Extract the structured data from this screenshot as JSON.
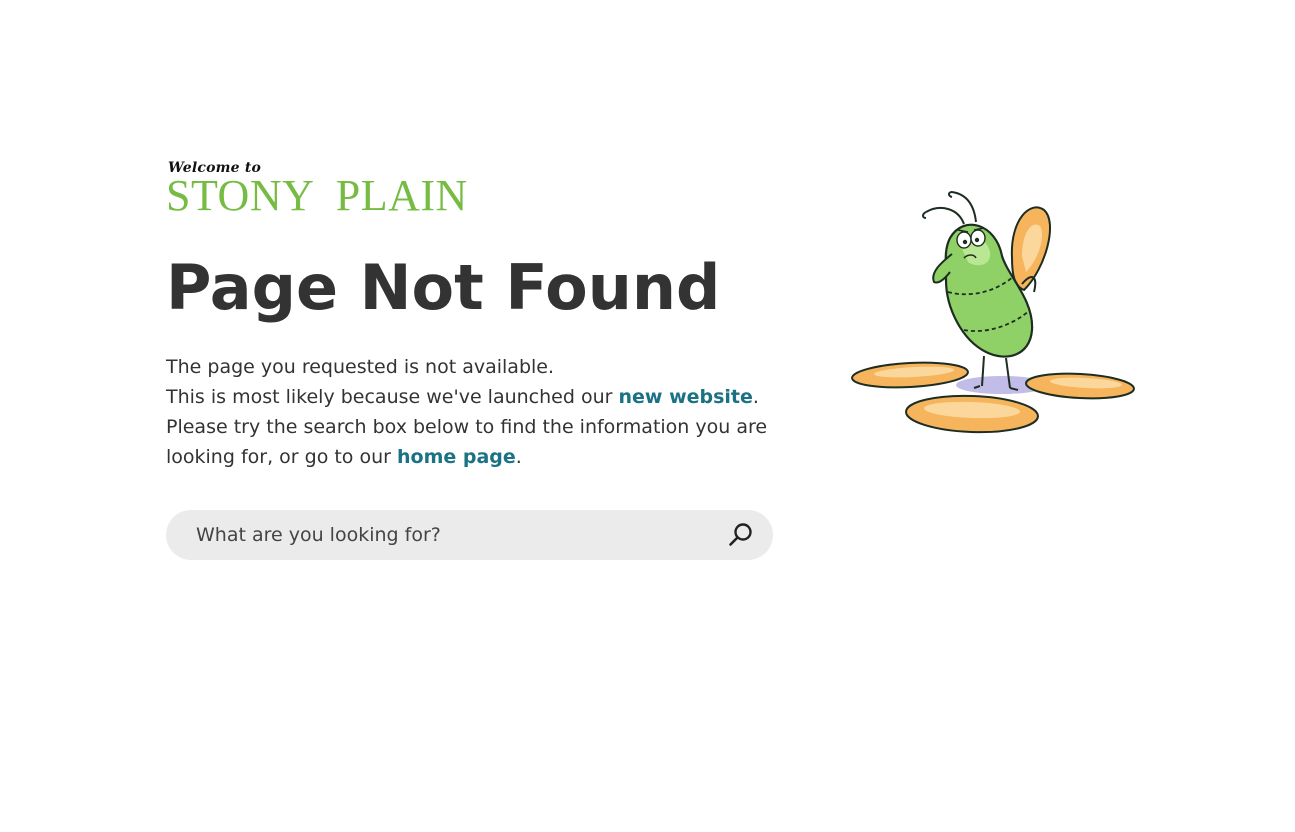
{
  "logo": {
    "welcome": "Welcome to",
    "name": "STONY  PLAIN",
    "color": "#76bc43"
  },
  "title": "Page Not Found",
  "message": {
    "line1": "The page you requested is not available.",
    "line2_prefix": "This is most likely because we've launched our ",
    "line2_link": "new website",
    "line2_suffix": ".",
    "line3_prefix": "Please try the search box below to find the information you are looking for, or go to our ",
    "line3_link": "home page",
    "line3_suffix": "."
  },
  "search": {
    "placeholder": "What are you looking for?",
    "value": "",
    "icon": "search-icon"
  },
  "illustration": {
    "icon": "bug-character-illustration"
  },
  "colors": {
    "link": "#1b7285",
    "text": "#333333",
    "search_bg": "#ebebeb",
    "bug_green": "#8fd166",
    "petal_orange": "#f6b45c"
  }
}
